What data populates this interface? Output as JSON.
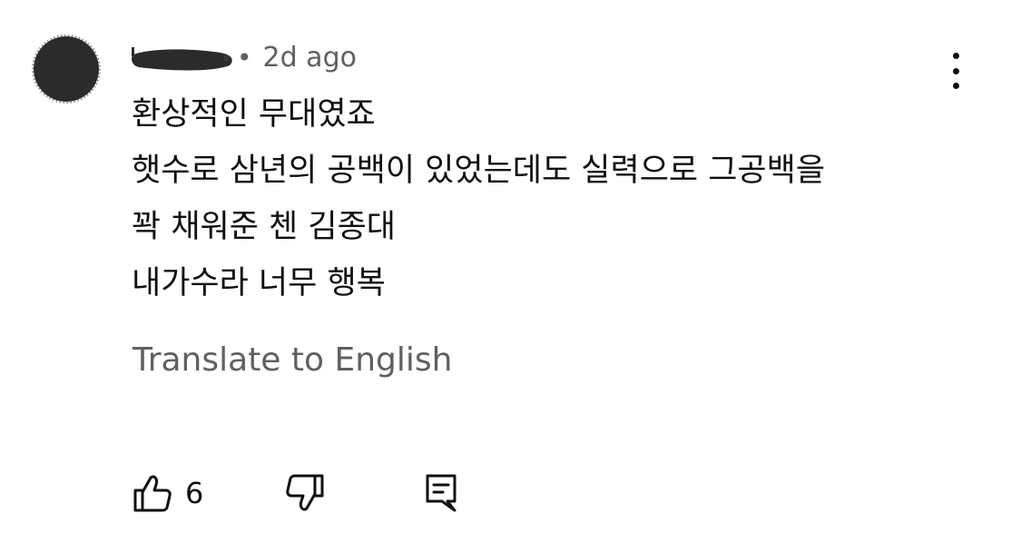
{
  "comment": {
    "username": "",
    "timestamp": "2d ago",
    "separator": "•",
    "lines": [
      "환상적인 무대였죠",
      "햇수로 삼년의 공백이 있었는데도 실력으로 그공백을",
      "꽉 채워준 첸 김종대",
      "내가수라 너무 행복"
    ],
    "translate_label": "Translate to English",
    "like_count": "6"
  },
  "icons": {
    "avatar": "avatar-redacted",
    "username": "username-redacted",
    "more": "more-vertical-icon",
    "like": "thumbs-up-icon",
    "dislike": "thumbs-down-icon",
    "reply": "reply-comment-icon"
  },
  "colors": {
    "text_primary": "#0f0f0f",
    "text_secondary": "#606060",
    "background": "#ffffff",
    "redaction": "#2b2b2b"
  }
}
